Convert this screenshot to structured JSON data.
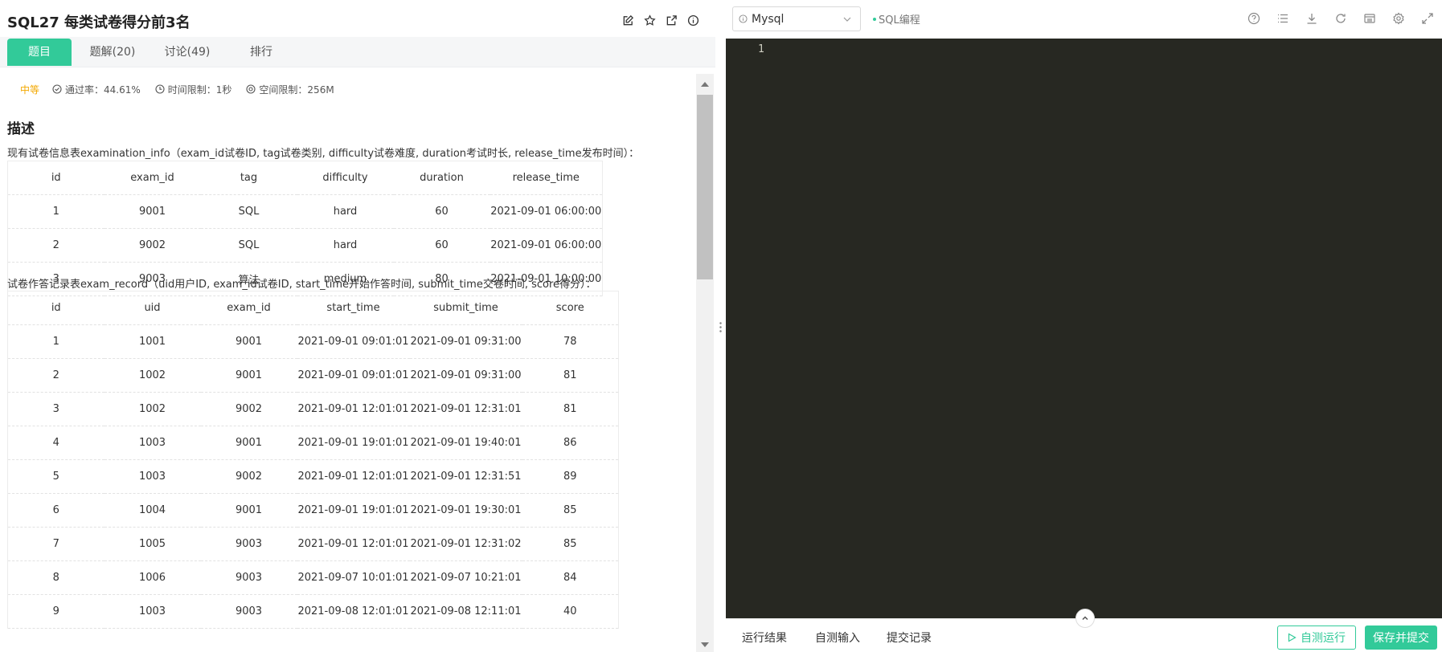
{
  "problem": {
    "title": "SQL27  每类试卷得分前3名",
    "difficulty": "中等",
    "pass_rate": "通过率：44.61%",
    "time_limit": "时间限制：1秒",
    "space_limit": "空间限制：256M"
  },
  "tabs": [
    {
      "label": "题目"
    },
    {
      "label": "题解(20)"
    },
    {
      "label": "讨论(49)"
    },
    {
      "label": "排行"
    }
  ],
  "description": {
    "heading": "描述",
    "info_text": "现有试卷信息表examination_info（exam_id试卷ID, tag试卷类别, difficulty试卷难度, duration考试时长, release_time发布时间）：",
    "record_text": "试卷作答记录表exam_record（uid用户ID, exam_id试卷ID, start_time开始作答时间, submit_time交卷时间, score得分）："
  },
  "examination_info": {
    "headers": [
      "id",
      "exam_id",
      "tag",
      "difficulty",
      "duration",
      "release_time"
    ],
    "rows": [
      [
        "1",
        "9001",
        "SQL",
        "hard",
        "60",
        "2021-09-01 06:00:00"
      ],
      [
        "2",
        "9002",
        "SQL",
        "hard",
        "60",
        "2021-09-01 06:00:00"
      ],
      [
        "3",
        "9003",
        "算法",
        "medium",
        "80",
        "2021-09-01 10:00:00"
      ]
    ]
  },
  "exam_record": {
    "headers": [
      "id",
      "uid",
      "exam_id",
      "start_time",
      "submit_time",
      "score"
    ],
    "rows": [
      [
        "1",
        "1001",
        "9001",
        "2021-09-01 09:01:01",
        "2021-09-01 09:31:00",
        "78"
      ],
      [
        "2",
        "1002",
        "9001",
        "2021-09-01 09:01:01",
        "2021-09-01 09:31:00",
        "81"
      ],
      [
        "3",
        "1002",
        "9002",
        "2021-09-01 12:01:01",
        "2021-09-01 12:31:01",
        "81"
      ],
      [
        "4",
        "1003",
        "9001",
        "2021-09-01 19:01:01",
        "2021-09-01 19:40:01",
        "86"
      ],
      [
        "5",
        "1003",
        "9002",
        "2021-09-01 12:01:01",
        "2021-09-01 12:31:51",
        "89"
      ],
      [
        "6",
        "1004",
        "9001",
        "2021-09-01 19:01:01",
        "2021-09-01 19:30:01",
        "85"
      ],
      [
        "7",
        "1005",
        "9003",
        "2021-09-01 12:01:01",
        "2021-09-01 12:31:02",
        "85"
      ],
      [
        "8",
        "1006",
        "9003",
        "2021-09-07 10:01:01",
        "2021-09-07 10:21:01",
        "84"
      ],
      [
        "9",
        "1003",
        "9003",
        "2021-09-08 12:01:01",
        "2021-09-08 12:11:01",
        "40"
      ]
    ]
  },
  "editor": {
    "language": "Mysql",
    "mode_tag": "SQL编程",
    "line_number": "1"
  },
  "bottom": {
    "tab_result": "运行结果",
    "tab_input": "自测输入",
    "tab_history": "提交记录",
    "run_label": "自测运行",
    "submit_label": "保存并提交"
  },
  "colors": {
    "accent": "#32ca99",
    "difficulty": "#f3a800",
    "editor_bg": "#272822"
  }
}
